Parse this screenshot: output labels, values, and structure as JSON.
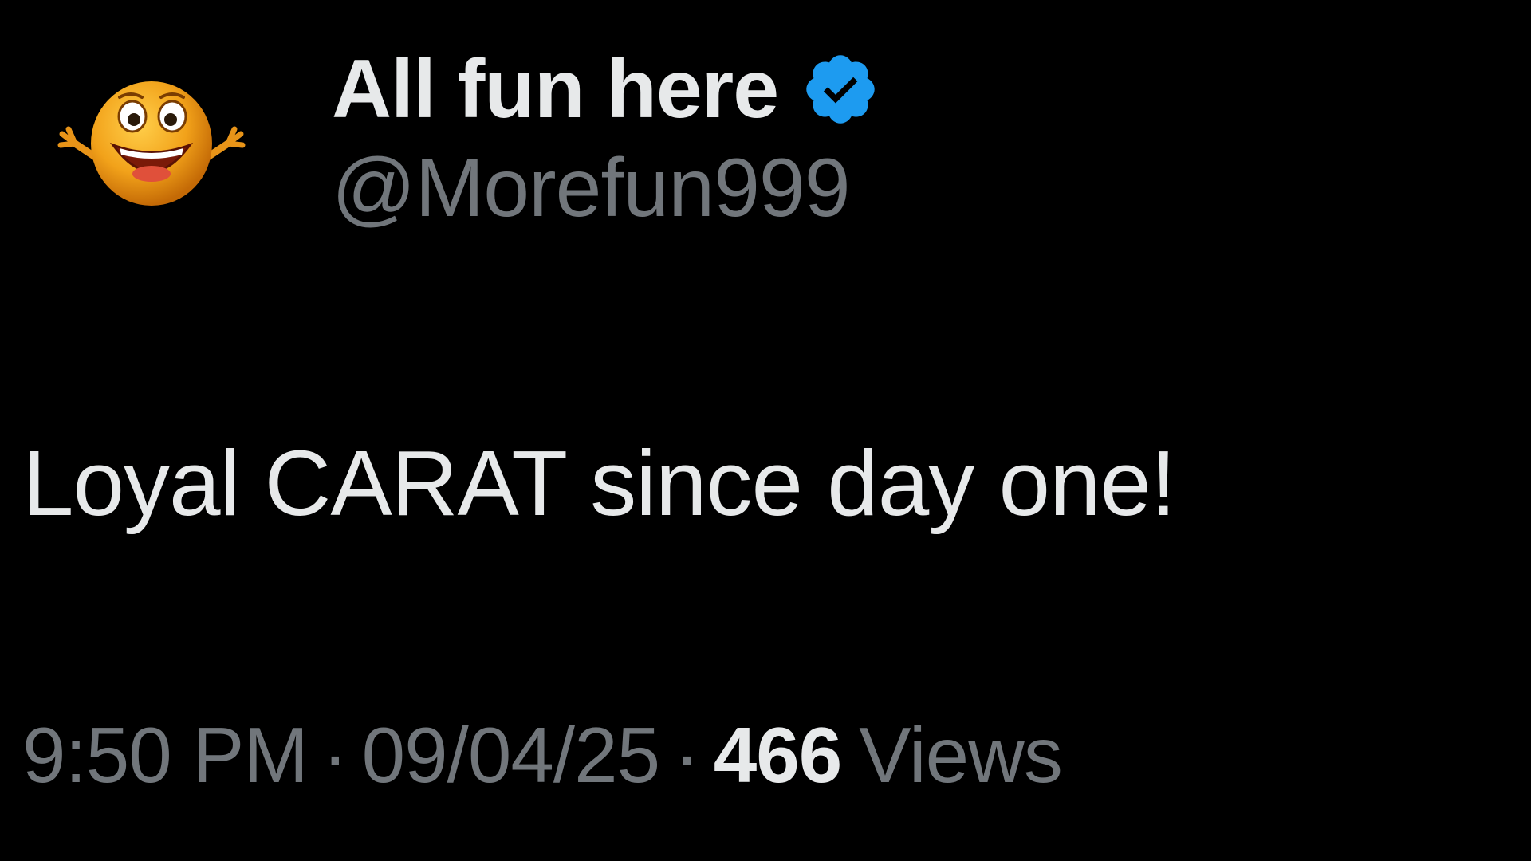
{
  "author": {
    "display_name": "All fun here",
    "handle": "@Morefun999",
    "avatar_icon": "smiley-face-avatar",
    "verified_icon": "verified-badge-icon",
    "verified_color": "#1d9bf0"
  },
  "tweet": {
    "text": "Loyal CARAT since day one!"
  },
  "meta": {
    "time": "9:50 PM",
    "separator": "·",
    "date": "09/04/25",
    "views_count": "466",
    "views_label": "Views"
  },
  "colors": {
    "background": "#000000",
    "primary_text": "#e7e9ea",
    "secondary_text": "#71767b"
  }
}
